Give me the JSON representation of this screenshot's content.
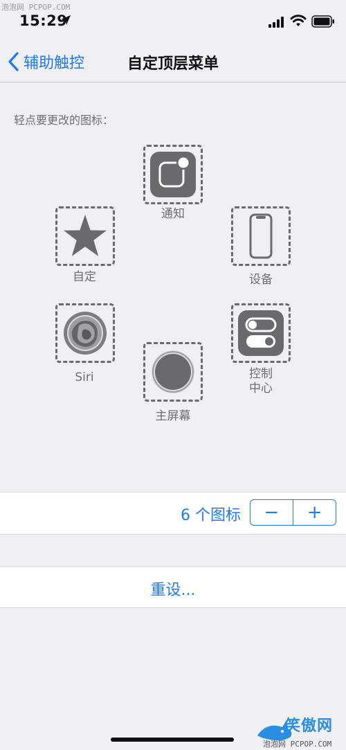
{
  "status_bar": {
    "time": "15:29",
    "watermark": "泡泡网 PCPOP.COM",
    "location_icon": "location-arrow-icon",
    "signal_icon": "cellular-signal-icon",
    "wifi_icon": "wifi-icon",
    "battery_icon": "battery-icon"
  },
  "nav": {
    "back_label": "辅助触控",
    "back_icon": "chevron-left-icon",
    "title": "自定顶层菜单"
  },
  "instruction": "轻点要更改的图标：",
  "icons": {
    "notification": {
      "label": "通知",
      "icon": "notification-icon"
    },
    "custom": {
      "label": "自定",
      "icon": "star-icon"
    },
    "device": {
      "label": "设备",
      "icon": "iphone-icon"
    },
    "siri": {
      "label": "Siri",
      "icon": "siri-icon"
    },
    "control_center": {
      "label_line1": "控制",
      "label_line2": "中心",
      "icon": "toggle-switches-icon"
    },
    "home": {
      "label": "主屏幕",
      "icon": "home-button-icon"
    }
  },
  "stepper": {
    "count_label": "6 个图标",
    "minus": "−",
    "plus": "+"
  },
  "reset": {
    "label": "重设..."
  },
  "bottom_watermark": {
    "brand": "笑傲网",
    "small": "泡泡网 PCPOP.COM",
    "logo_icon": "shark-logo-icon"
  },
  "colors": {
    "accent": "#1d7af0",
    "background": "#efeff4",
    "icon_gray": "#6a6a6e"
  }
}
